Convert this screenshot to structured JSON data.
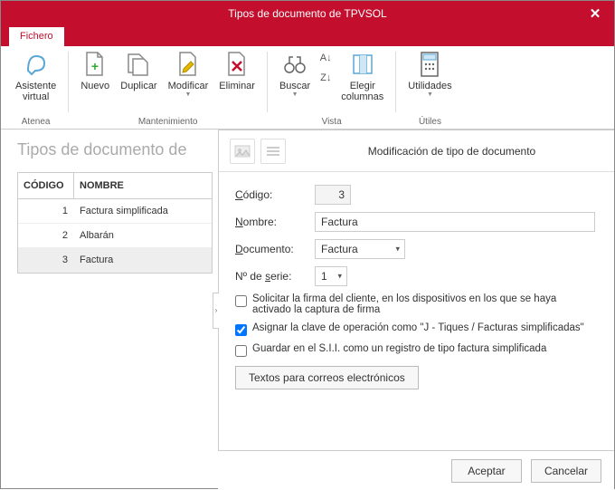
{
  "window": {
    "title": "Tipos de documento de TPVSOL"
  },
  "tabs": {
    "file": "Fichero"
  },
  "ribbon": {
    "atenea": {
      "assistant": "Asistente\nvirtual",
      "group": "Atenea"
    },
    "maintenance": {
      "new": "Nuevo",
      "duplicate": "Duplicar",
      "modify": "Modificar",
      "delete": "Eliminar",
      "group": "Mantenimiento"
    },
    "view": {
      "find": "Buscar",
      "choose_cols": "Elegir\ncolumnas",
      "group": "Vista"
    },
    "utils": {
      "utilities": "Utilidades",
      "group": "Útiles"
    }
  },
  "left": {
    "heading": "Tipos de documento de",
    "cols": {
      "code": "CÓDIGO",
      "name": "NOMBRE"
    },
    "rows": [
      {
        "code": "1",
        "name": "Factura simplificada"
      },
      {
        "code": "2",
        "name": "Albarán"
      },
      {
        "code": "3",
        "name": "Factura"
      }
    ],
    "selected": 2
  },
  "panel": {
    "title": "Modificación de tipo de documento",
    "labels": {
      "code": "Código:",
      "name": "Nombre:",
      "document": "Documento:",
      "series": "Nº de serie:"
    },
    "values": {
      "code": "3",
      "name": "Factura",
      "document": "Factura",
      "series": "1"
    },
    "checks": {
      "sign": "Solicitar la firma del cliente, en los dispositivos en los que se haya activado la captura de firma",
      "assign": "Asignar la clave de operación como \"J - Tiques / Facturas simplificadas\"",
      "sii": "Guardar en el S.I.I. como un registro de tipo factura simplificada"
    },
    "btn_email": "Textos para correos electrónicos"
  },
  "buttons": {
    "ok": "Aceptar",
    "cancel": "Cancelar"
  }
}
